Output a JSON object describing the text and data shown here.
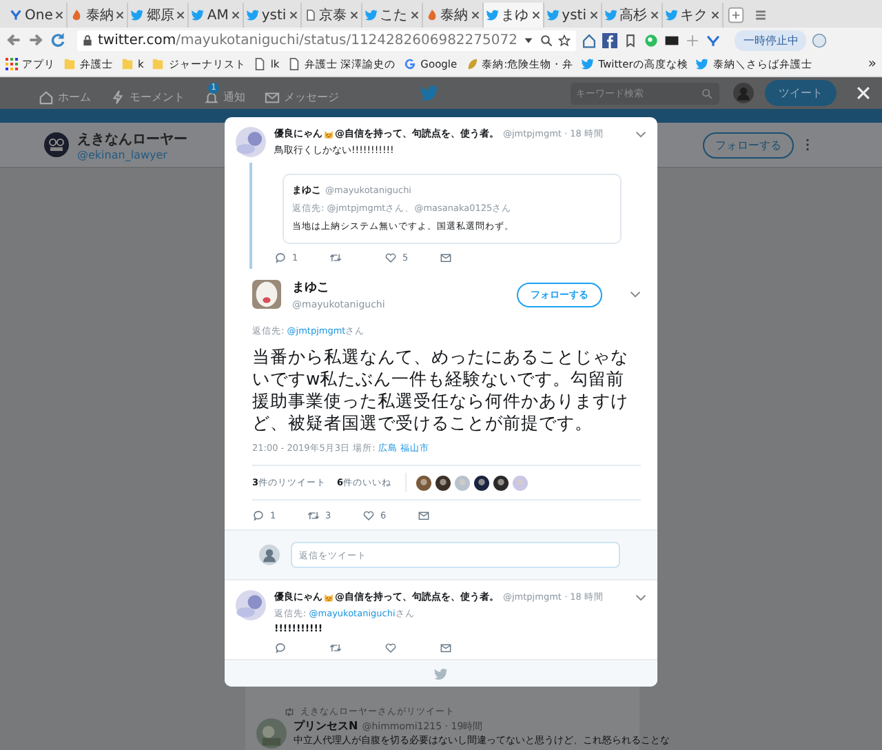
{
  "browser": {
    "tabs": [
      {
        "title": "One",
        "kind": "y",
        "selected": false
      },
      {
        "title": "泰納",
        "kind": "fire",
        "selected": false
      },
      {
        "title": "郷原",
        "kind": "bird",
        "selected": false
      },
      {
        "title": "AM",
        "kind": "bird",
        "selected": false
      },
      {
        "title": "ysti",
        "kind": "bird",
        "selected": false
      },
      {
        "title": "京泰",
        "kind": "doc",
        "selected": false
      },
      {
        "title": "こた",
        "kind": "bird",
        "selected": false
      },
      {
        "title": "泰納",
        "kind": "fire",
        "selected": false
      },
      {
        "title": "まゆ",
        "kind": "bird",
        "selected": true
      },
      {
        "title": "ysti",
        "kind": "bird",
        "selected": false
      },
      {
        "title": "高杉",
        "kind": "bird",
        "selected": false
      },
      {
        "title": "キク",
        "kind": "bird",
        "selected": false
      }
    ],
    "address": {
      "host": "twitter.com",
      "path": "/mayukotaniguchi/status/1124282606982275072"
    },
    "pause_label": "一時停止中",
    "bookmarks": [
      {
        "label": "アプリ",
        "kind": "apps"
      },
      {
        "label": "弁護士",
        "kind": "folder"
      },
      {
        "label": "k",
        "kind": "folder"
      },
      {
        "label": "ジャーナリスト",
        "kind": "folder"
      },
      {
        "label": "lk",
        "kind": "page"
      },
      {
        "label": "弁護士 深澤諭史の",
        "kind": "page"
      },
      {
        "label": "Google",
        "kind": "google"
      },
      {
        "label": "泰納:危険生物・弁",
        "kind": "leaf"
      },
      {
        "label": "Twitterの高度な検",
        "kind": "bird"
      },
      {
        "label": "泰納＼さらば弁護士",
        "kind": "bird"
      }
    ],
    "bookmarks_more": "»"
  },
  "nav": {
    "items": [
      {
        "label": "ホーム",
        "kind": "home"
      },
      {
        "label": "モーメント",
        "kind": "bolt"
      },
      {
        "label": "通知",
        "kind": "bell",
        "badge": "1"
      },
      {
        "label": "メッセージ",
        "kind": "mail"
      }
    ],
    "search": {
      "placeholder": "キーワード検索"
    },
    "tweet_button": "ツイート"
  },
  "profile": {
    "name": "えきなんローヤー",
    "handle": "@ekinan_lawyer",
    "follow": "フォローする"
  },
  "modal": {
    "parent": {
      "name": "優良にゃん",
      "name_suffix": "@自信を持って、句読点を、使う者。",
      "handle": "@jmtpjmgmt",
      "time": "· 18 時間",
      "text": "鳥取行くしかない!!!!!!!!!!!",
      "quote": {
        "name": "まゆこ",
        "handle": "@mayukotaniguchi",
        "reply_prefix": "返信先:",
        "reply_to": "@jmtpjmgmtさん、@masanaka0125さん",
        "text": "当地は上納システム無いですよ。国選私選問わず。"
      },
      "actions": [
        {
          "kind": "reply",
          "count": "1"
        },
        {
          "kind": "retweet"
        },
        {
          "kind": "like",
          "count": "5"
        },
        {
          "kind": "mail"
        }
      ]
    },
    "main": {
      "name": "まゆこ",
      "handle": "@mayukotaniguchi",
      "follow": "フォローする",
      "reply_prefix": "返信先:",
      "reply_to": "@jmtpjmgmt",
      "reply_suffix": "さん",
      "text": "当番から私選なんて、めったにあることじゃないですw私たぶん一件も経験ないです。勾留前援助事業使った私選受任なら何件かありますけど、被疑者国選で受けることが前提です。",
      "date": "21:00 - 2019年5月3日",
      "place_label": "場所:",
      "place": "広島 福山市",
      "retweets": {
        "count": "3",
        "label": "件のリツイート"
      },
      "likes": {
        "count": "6",
        "label": "件のいいね"
      },
      "actions": [
        {
          "kind": "reply",
          "count": "1"
        },
        {
          "kind": "retweet",
          "count": "3"
        },
        {
          "kind": "like",
          "count": "6"
        },
        {
          "kind": "mail"
        }
      ]
    },
    "reply_box": {
      "placeholder": "返信をツイート"
    },
    "reply": {
      "name": "優良にゃん",
      "name_suffix": "@自信を持って、句読点を、使う者。",
      "handle": "@jmtpjmgmt",
      "time": "· 18 時間",
      "reply_prefix": "返信先:",
      "reply_to": "@mayukotaniguchi",
      "reply_suffix": "さん",
      "text": "!!!!!!!!!!!",
      "actions": [
        {
          "kind": "reply"
        },
        {
          "kind": "retweet"
        },
        {
          "kind": "like"
        },
        {
          "kind": "mail"
        }
      ]
    }
  },
  "timeline_behind": {
    "retweeted_by": "えきなんローヤー",
    "retweeted_suffix": "さんがリツイート",
    "name": "プリンセスN",
    "handle": "@himmomi1215",
    "time": "· 19時間",
    "text": "中立人代理人が自腹を切る必要はないし間違ってないと思うけど、これ怒られることな"
  }
}
